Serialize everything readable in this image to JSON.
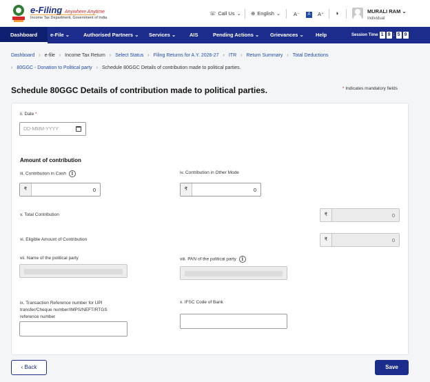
{
  "brand": {
    "title": "e-Filing",
    "tagline": "Anywhere Anytime",
    "subtitle": "Income Tax Department, Government of India"
  },
  "header": {
    "call_us": "Call Us",
    "language": "English",
    "font_decrease": "A",
    "font_normal": "A",
    "font_increase": "A",
    "user_name": "MURALI RAM",
    "user_role": "Individual"
  },
  "nav": {
    "items": [
      {
        "label": "Dashboard"
      },
      {
        "label": "e-File"
      },
      {
        "label": "Authorised Partners"
      },
      {
        "label": "Services"
      },
      {
        "label": "AIS"
      },
      {
        "label": "Pending Actions"
      },
      {
        "label": "Grievances"
      },
      {
        "label": "Help"
      }
    ],
    "session_label": "Session Time",
    "session_digits": [
      "1",
      "9",
      "5",
      "9"
    ]
  },
  "breadcrumb": {
    "row1": [
      "Dashboard",
      "e-file",
      "Income Tax Return",
      "Select Status",
      "Filing Returns for A.Y. 2026-27",
      "ITR",
      "Return Summary",
      "Total Deductions"
    ],
    "row2": [
      "80GGC - Donation to Political party",
      "Schedule 80GGC Details of contribution made to political parties."
    ]
  },
  "page": {
    "title": "Schedule 80GGC Details of contribution made to political parties.",
    "mandatory_note": "Indicates mandatory fields"
  },
  "form": {
    "date_label": "ii. Date",
    "date_placeholder": "DD-MMM-YYYY",
    "section_title": "Amount of contribution",
    "cash_label": "iii. Contribution in Cash",
    "cash_value": "0",
    "other_label": "iv. Contribution in Other Mode",
    "other_value": "0",
    "total_label": "v. Total Contribution",
    "total_value": "0",
    "eligible_label": "vi. Eligible Amount of Contribution",
    "eligible_value": "0",
    "party_name_label": "vii. Name of the political party",
    "party_pan_label": "viii. PAN of the political party",
    "txn_label": "ix. Transaction Reference number for UPI transfer/Cheque number/IMPS/NEFT/RTGS reference number",
    "ifsc_label": "x. IFSC Code of Bank",
    "currency_symbol": "₹"
  },
  "buttons": {
    "back": "Back",
    "save": "Save"
  },
  "colors": {
    "primary": "#1c2c8c",
    "accent_red": "#d62828"
  }
}
